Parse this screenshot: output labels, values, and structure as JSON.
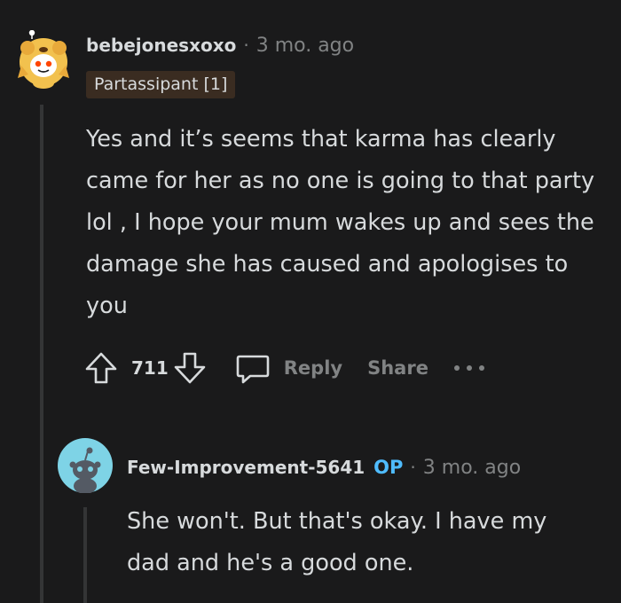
{
  "comments": [
    {
      "username": "bebejonesxoxo",
      "separator": "·",
      "time": "3 mo. ago",
      "flair": "Partassipant [1]",
      "body": "Yes and it’s seems that karma has clearly came for her as no one is going to that party lol , I hope your mum wakes up and sees the damage she has caused and apologises to you",
      "score": "711",
      "reply_label": "Reply",
      "share_label": "Share",
      "icons": {
        "avatar": "snoo-lion-costume-avatar",
        "upvote": "arrow-up-icon",
        "downvote": "arrow-down-icon",
        "reply": "speech-bubble-icon",
        "more": "ellipsis-icon"
      }
    },
    {
      "username": "Few-Improvement-5641",
      "op_badge": "OP",
      "separator": "·",
      "time": "3 mo. ago",
      "body": "She won't. But that's okay. I have my dad and he's a good one.",
      "icons": {
        "avatar": "default-snoo-avatar"
      }
    }
  ],
  "colors": {
    "background": "#1a1a1b",
    "text": "#d7dadc",
    "muted": "#818384",
    "flair_bg": "#3a2c21",
    "op_badge": "#4fbcff",
    "thread_line": "#343536",
    "avatar2_bg": "#7ed3e6"
  }
}
